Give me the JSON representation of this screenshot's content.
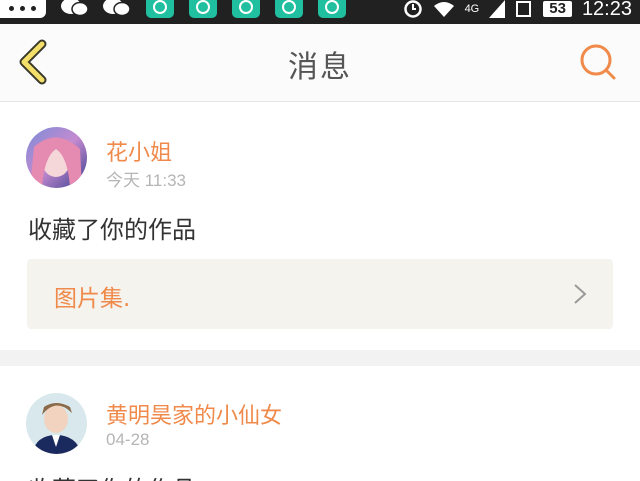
{
  "status_bar": {
    "network": "4G",
    "battery": "53",
    "time": "12:23"
  },
  "header": {
    "title": "消息",
    "back_icon": "chevron-left-icon",
    "search_icon": "search-icon"
  },
  "messages": [
    {
      "username": "花小姐",
      "time": "今天 11:33",
      "action": "收藏了你的作品",
      "attachment_title": "图片集."
    },
    {
      "username": "黄明昊家的小仙女",
      "time": "04-28",
      "action": "收藏了你的作品"
    }
  ],
  "colors": {
    "accent": "#f08a4b",
    "back_icon_fill": "#f3df6a",
    "status_bar": "#212121"
  }
}
